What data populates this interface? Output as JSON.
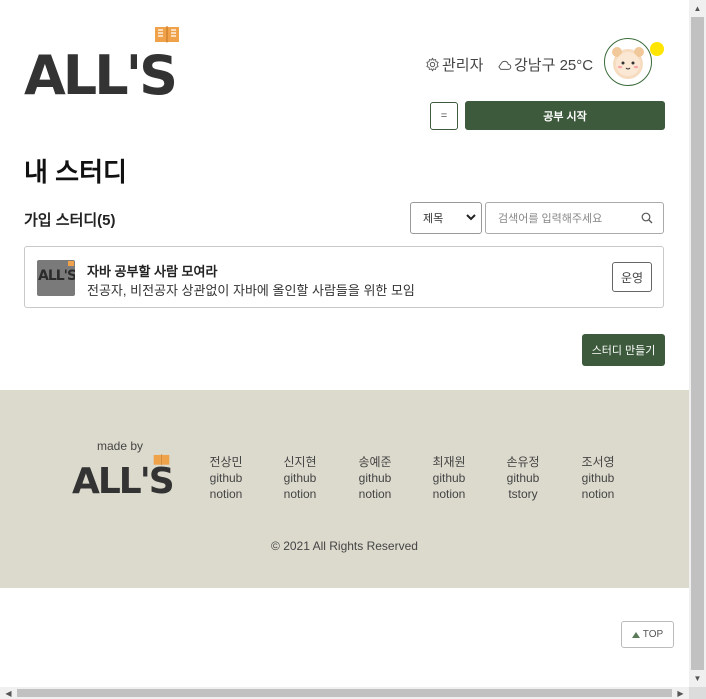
{
  "header": {
    "logo_text": "ALL'S",
    "admin_label": "관리자",
    "weather_label": "강남구 25°C",
    "start_button": "공부 시작",
    "menu_button": "="
  },
  "main": {
    "title": "내 스터디",
    "section_title": "가입 스터디(5)",
    "filter": {
      "selected": "제목"
    },
    "search": {
      "placeholder": "검색어를 입력해주세요"
    },
    "studies": [
      {
        "thumb_text": "ALL'S",
        "name": "자바 공부할 사람 모여라",
        "description": "전공자, 비전공자 상관없이 자바에 올인할 사람들을 위한 모임",
        "role": "운영"
      }
    ],
    "create_button": "스터디 만들기"
  },
  "footer": {
    "made_by": "made by",
    "logo_text": "ALL'S",
    "members": [
      {
        "name": "전상민",
        "link1": "github",
        "link2": "notion"
      },
      {
        "name": "신지현",
        "link1": "github",
        "link2": "notion"
      },
      {
        "name": "송예준",
        "link1": "github",
        "link2": "notion"
      },
      {
        "name": "최재원",
        "link1": "github",
        "link2": "notion"
      },
      {
        "name": "손유정",
        "link1": "github",
        "link2": "tstory"
      },
      {
        "name": "조서영",
        "link1": "github",
        "link2": "notion"
      }
    ],
    "copyright": "© 2021 All Rights Reserved"
  },
  "top_button": "TOP",
  "colors": {
    "brand_green": "#3d5a3d",
    "logo_orange": "#f0a24a",
    "footer_bg": "#dcdacd",
    "status_dot": "#ffe500"
  }
}
